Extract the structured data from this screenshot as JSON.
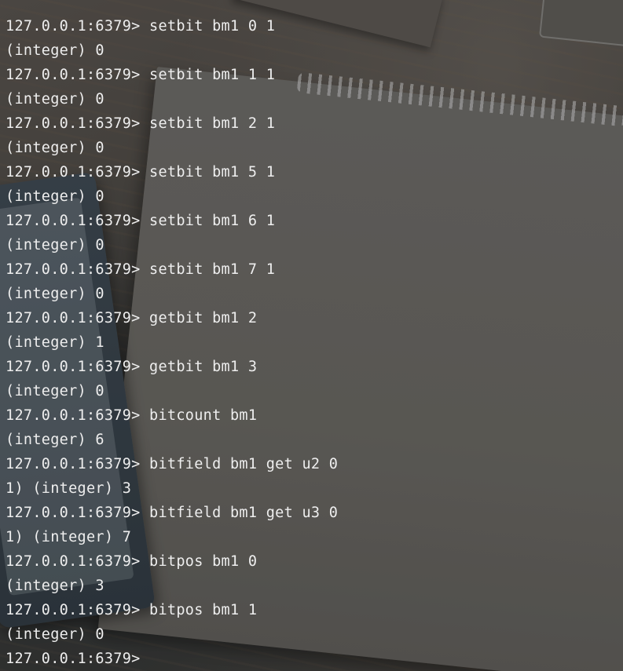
{
  "terminal": {
    "lines": [
      "127.0.0.1:6379> setbit bm1 0 1",
      "(integer) 0",
      "127.0.0.1:6379> setbit bm1 1 1",
      "(integer) 0",
      "127.0.0.1:6379> setbit bm1 2 1",
      "(integer) 0",
      "127.0.0.1:6379> setbit bm1 5 1",
      "(integer) 0",
      "127.0.0.1:6379> setbit bm1 6 1",
      "(integer) 0",
      "127.0.0.1:6379> setbit bm1 7 1",
      "(integer) 0",
      "127.0.0.1:6379> getbit bm1 2",
      "(integer) 1",
      "127.0.0.1:6379> getbit bm1 3",
      "(integer) 0",
      "127.0.0.1:6379> bitcount bm1",
      "(integer) 6",
      "127.0.0.1:6379> bitfield bm1 get u2 0",
      "1) (integer) 3",
      "127.0.0.1:6379> bitfield bm1 get u3 0",
      "1) (integer) 7",
      "127.0.0.1:6379> bitpos bm1 0",
      "(integer) 3",
      "127.0.0.1:6379> bitpos bm1 1",
      "(integer) 0",
      "127.0.0.1:6379>"
    ]
  },
  "colors": {
    "text": "#eeeeee",
    "background": "#4a4744"
  }
}
